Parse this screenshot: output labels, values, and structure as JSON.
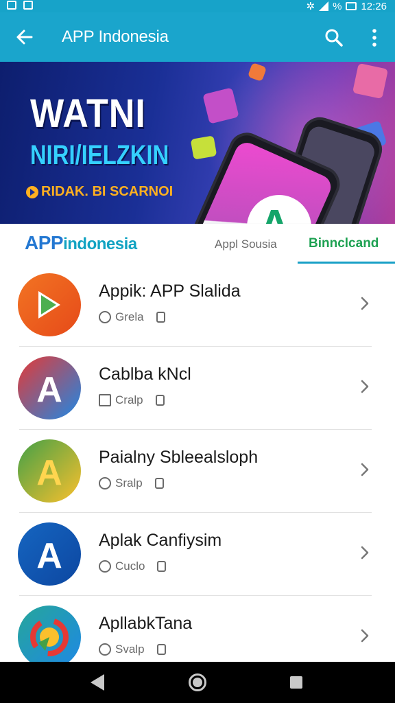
{
  "status_bar": {
    "time": "12:26",
    "battery_text": "%"
  },
  "app_bar": {
    "title": "APP Indonesia"
  },
  "banner": {
    "headline": "WATNI",
    "subheadline": "NIRI/IELZKIN",
    "tagline": "RIDAK. BI SCARNOI"
  },
  "tabs": {
    "brand_part1": "APP",
    "brand_part2": "indonesia",
    "tab1": "Appl Sousia",
    "tab2": "Binnclcand",
    "active_tab": "tab2"
  },
  "apps": [
    {
      "name": "Appik: APP Slalida",
      "meta": "Grela",
      "icon": "play-store-icon",
      "colors": [
        "#f27423",
        "#e64a19"
      ]
    },
    {
      "name": "Cablba kNcl",
      "meta": "Cralp",
      "icon": "letter-a-icon",
      "colors": [
        "#e53935",
        "#1e88e5"
      ]
    },
    {
      "name": "Paialny Sbleealsloph",
      "meta": "Sralp",
      "icon": "green-a-icon",
      "colors": [
        "#43a047",
        "#fbc02d"
      ]
    },
    {
      "name": "Aplak Canfiysim",
      "meta": "Cuclo",
      "icon": "blue-a-icon",
      "colors": [
        "#1565c0",
        "#0d47a1"
      ]
    },
    {
      "name": "ApllabkTana",
      "meta": "Svalp",
      "icon": "colorful-circle-icon",
      "colors": [
        "#26a69a",
        "#1e88e5"
      ]
    }
  ]
}
